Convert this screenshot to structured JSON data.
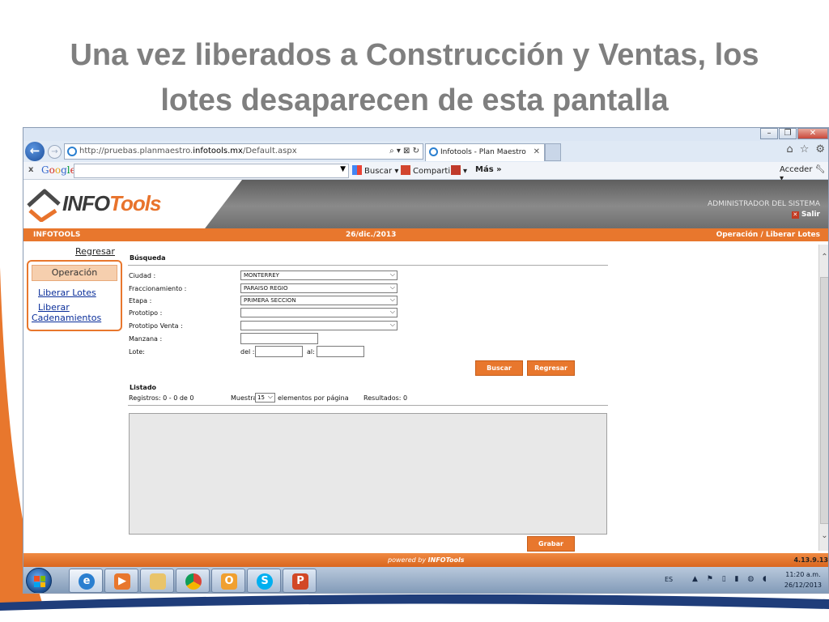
{
  "slide": {
    "title_line1": "Una vez liberados a Construcción y Ventas, los",
    "title_line2": "lotes desaparecen de esta pantalla"
  },
  "browser": {
    "url_prefix": "http://pruebas.planmaestro.",
    "url_host": "infotools.mx",
    "url_path": "/Default.aspx",
    "tab_title": "Infotools - Plan Maestro",
    "toolbar": {
      "close": "x",
      "google_letters": [
        "G",
        "o",
        "o",
        "g",
        "l",
        "e"
      ],
      "buscar": "Buscar",
      "compartir": "Compartir",
      "mas": "Más »",
      "acceder": "Acceder"
    }
  },
  "app": {
    "logo_info": "INFO",
    "logo_tools": "Tools",
    "user_role": "ADMINISTRADOR DEL SISTEMA",
    "salir": "Salir",
    "bar": {
      "company": "INFOTOOLS",
      "date": "26/dic./2013",
      "section": "Operación / Liberar Lotes"
    },
    "nav": {
      "back": "Regresar",
      "header": "Operación",
      "items": [
        "Liberar Lotes",
        "Liberar",
        "Cadenamientos"
      ]
    },
    "form": {
      "title": "Búsqueda",
      "fields": {
        "ciudad_label": "Ciudad :",
        "ciudad_value": "MONTERREY",
        "fracc_label": "Fraccionamiento :",
        "fracc_value": "PARAISO REGIO",
        "etapa_label": "Etapa :",
        "etapa_value": "PRIMERA SECCION",
        "prototipo_label": "Prototipo :",
        "prototipo_value": "",
        "prototipo_venta_label": "Prototipo Venta :",
        "prototipo_venta_value": "",
        "manzana_label": "Manzana :",
        "lote_label": "Lote:",
        "del_label": "del :",
        "al_label": "al:"
      },
      "buscar_btn": "Buscar",
      "regresar_btn": "Regresar"
    },
    "listado": {
      "title": "Listado",
      "registros": "Registros: 0 - 0 de 0",
      "muestra": "Muestra",
      "page_size": "15",
      "por_pagina": "elementos por página",
      "resultados": "Resultados: 0"
    },
    "grabar_btn": "Grabar",
    "footer": {
      "powered": "powered by",
      "brand": "INFOTools",
      "version": "4.13.9.13"
    }
  },
  "taskbar": {
    "lang": "ES",
    "time": "11:20 a.m.",
    "date": "26/12/2013"
  },
  "colors": {
    "accent": "#e8772d",
    "title_gray": "#7f7f7f"
  }
}
